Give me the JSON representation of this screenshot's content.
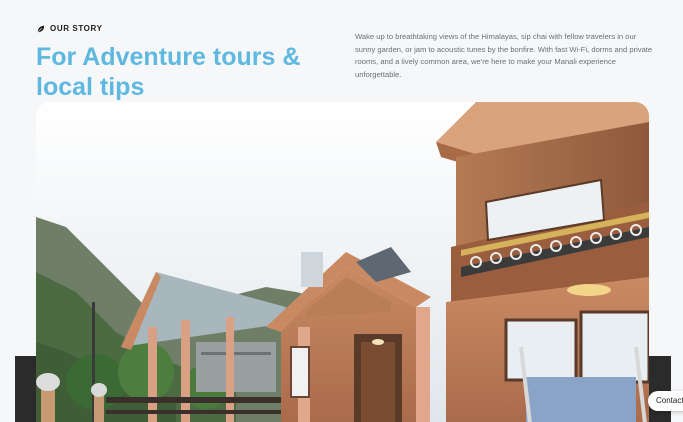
{
  "section": {
    "eyebrow_icon": "leaf-icon",
    "eyebrow": "OUR STORY",
    "headline": "For Adventure tours & local tips",
    "description": "Wake up to breathtaking views of the Himalayas, sip chai with fellow travelers in our sunny garden, or jam to acoustic tunes by the bonfire. With fast Wi-Fi, dorms and private rooms, and a lively common area, we're here to make your Manali experience unforgettable."
  },
  "photo": {
    "alt_subject": "hostel-building-photo"
  },
  "floating": {
    "contact_label": "Contact"
  },
  "colors": {
    "accent": "#5fb8e0",
    "background": "#f6f7f9",
    "dark_band": "#2b2b2b"
  }
}
